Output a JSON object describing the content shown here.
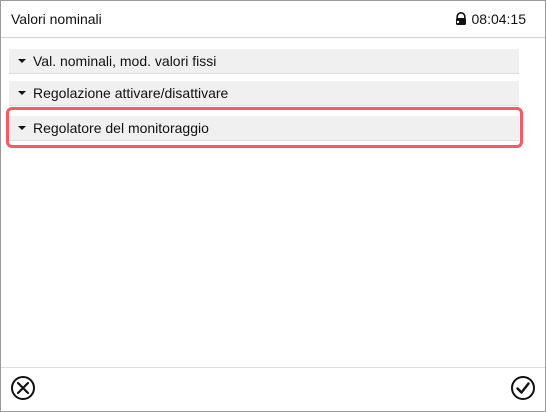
{
  "header": {
    "title": "Valori nominali",
    "time": "08:04:15",
    "icons": {
      "lock": "lock-icon"
    }
  },
  "menu": {
    "items": [
      {
        "label": "Val. nominali, mod. valori fissi",
        "icon": "chevron-down-icon"
      },
      {
        "label": "Regolazione attivare/disattivare",
        "icon": "chevron-down-icon"
      },
      {
        "label": "Regolatore del monitoraggio",
        "icon": "chevron-down-icon",
        "highlighted": true
      }
    ]
  },
  "footer": {
    "cancel_icon": "close-circle-icon",
    "confirm_icon": "check-circle-icon"
  },
  "colors": {
    "highlight": "#ef5d67",
    "item_background": "#f0f0f0",
    "text": "#111111"
  }
}
